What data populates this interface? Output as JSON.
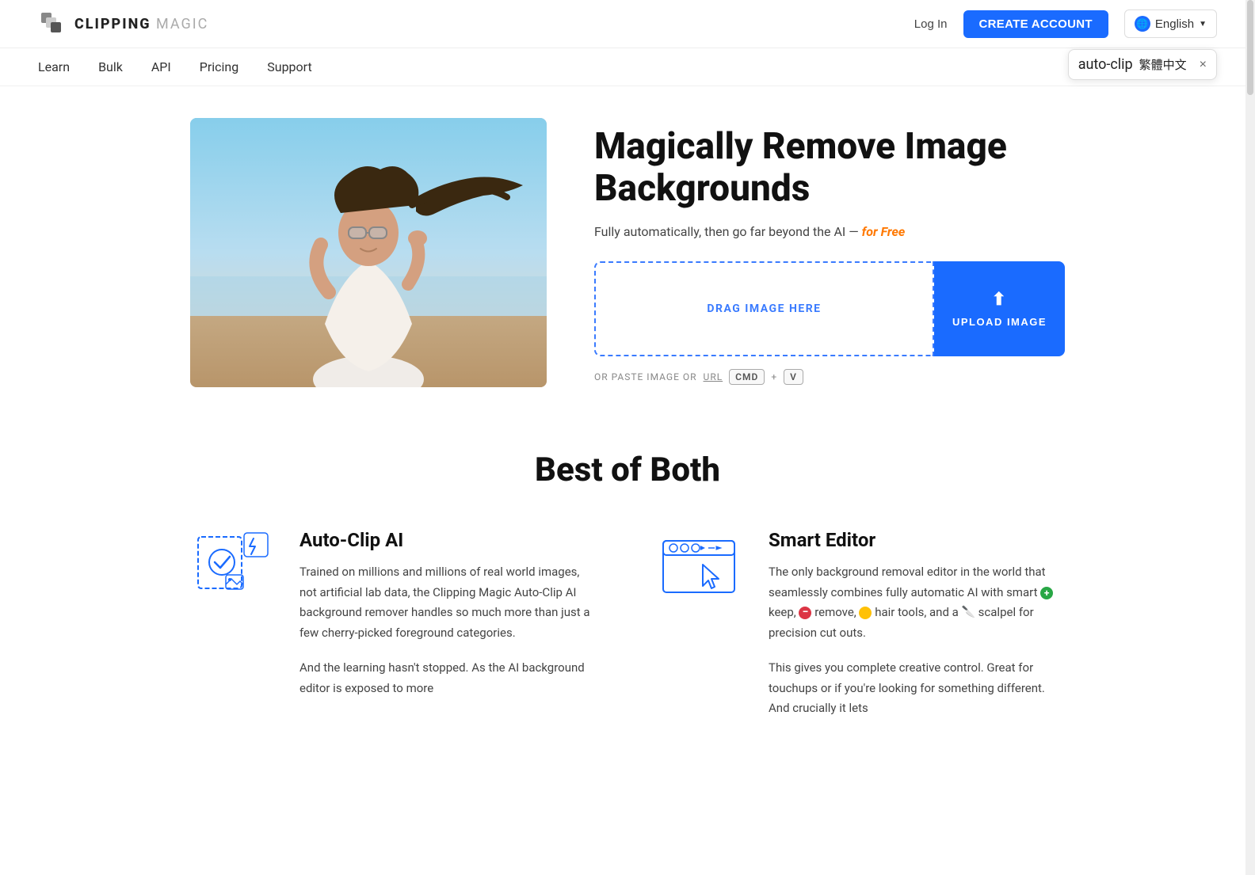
{
  "header": {
    "logo_text": "CLIPPING",
    "logo_magic": " MAGIC",
    "login_label": "Log In",
    "create_account_label": "CREATE ACCOUNT",
    "language_label": "English",
    "lang_dropdown_label": "繁體中文",
    "lang_flag": "🇹🇼",
    "close_label": "×"
  },
  "nav": {
    "items": [
      {
        "label": "Learn",
        "href": "#"
      },
      {
        "label": "Bulk",
        "href": "#"
      },
      {
        "label": "API",
        "href": "#"
      },
      {
        "label": "Pricing",
        "href": "#"
      },
      {
        "label": "Support",
        "href": "#"
      }
    ]
  },
  "hero": {
    "title": "Magically Remove Image Backgrounds",
    "subtitle_prefix": "Fully automatically, then go far beyond the AI — ",
    "subtitle_free": "for Free",
    "drag_label": "DRAG IMAGE HERE",
    "upload_label": "UPLOAD IMAGE",
    "paste_prefix": "OR PASTE IMAGE OR",
    "url_label": "URL",
    "cmd_label": "CMD",
    "plus_label": "+",
    "v_label": "V"
  },
  "best_section": {
    "title": "Best of Both",
    "features": [
      {
        "id": "auto-clip",
        "name": "Auto-Clip AI",
        "para1": "Trained on millions and millions of real world images, not artificial lab data, the Clipping Magic Auto-Clip AI background remover handles so much more than just a few cherry-picked foreground categories.",
        "para2": "And the learning hasn't stopped. As the AI background editor is exposed to more"
      },
      {
        "id": "smart-editor",
        "name": "Smart Editor",
        "para1": "The only background removal editor in the world that seamlessly combines fully automatic AI with smart",
        "keep_icon": true,
        "keep_label": "keep,",
        "remove_icon": true,
        "remove_label": "remove,",
        "hair_icon": true,
        "hair_label": "hair tools, and a",
        "scalpel_icon": true,
        "scalpel_label": "scalpel for precision cut outs.",
        "para2": "This gives you complete creative control. Great for touchups or if you're looking for something different. And crucially it lets"
      }
    ]
  }
}
